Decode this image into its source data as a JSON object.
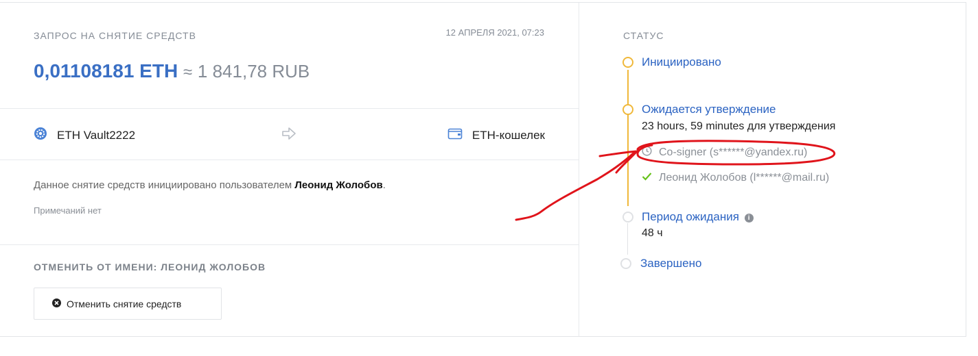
{
  "request": {
    "title": "ЗАПРОС НА СНЯТИЕ СРЕДСТВ",
    "date": "12 АПРЕЛЯ 2021, 07:23",
    "amount_eth": "0,01108181 ETH",
    "approx": "≈",
    "amount_rub": "1 841,78 RUB"
  },
  "transfer": {
    "from_label": "ETH Vault2222",
    "from_icon": "vault-gear-icon",
    "arrow_icon": "arrow-right-icon",
    "to_label": "ETH-кошелек",
    "to_icon": "wallet-icon"
  },
  "details": {
    "initiated_prefix": "Данное снятие средств инициировано пользователем",
    "initiated_user": "Леонид Жолобов",
    "initiated_suffix": ".",
    "notes": "Примечаний нет"
  },
  "cancel": {
    "title": "ОТМЕНИТЬ ОТ ИМЕНИ: ЛЕОНИД ЖОЛОБОВ",
    "button_label": "Отменить снятие средств",
    "button_icon": "close-circle-icon"
  },
  "status": {
    "title": "СТАТУС",
    "steps": [
      {
        "label": "Инициировано",
        "state": "active"
      },
      {
        "label": "Ожидается утверждение",
        "state": "active",
        "sub": "23 hours, 59 minutes для утверждения",
        "signers": [
          {
            "label": "Co-signer (s******@yandex.ru)",
            "icon": "clock-icon"
          },
          {
            "label": "Леонид Жолобов (l******@mail.ru)",
            "icon": "check-icon"
          }
        ]
      },
      {
        "label": "Период ожидания",
        "state": "pending",
        "sub": "48 ч",
        "info_icon": "info-icon"
      },
      {
        "label": "Завершено",
        "state": "pending"
      }
    ]
  },
  "colors": {
    "accent": "#3a6fc4",
    "link": "#2b63c2",
    "pending_gold": "#f0b83a",
    "check_green": "#66c21b",
    "annotation_red": "#e0141b"
  }
}
